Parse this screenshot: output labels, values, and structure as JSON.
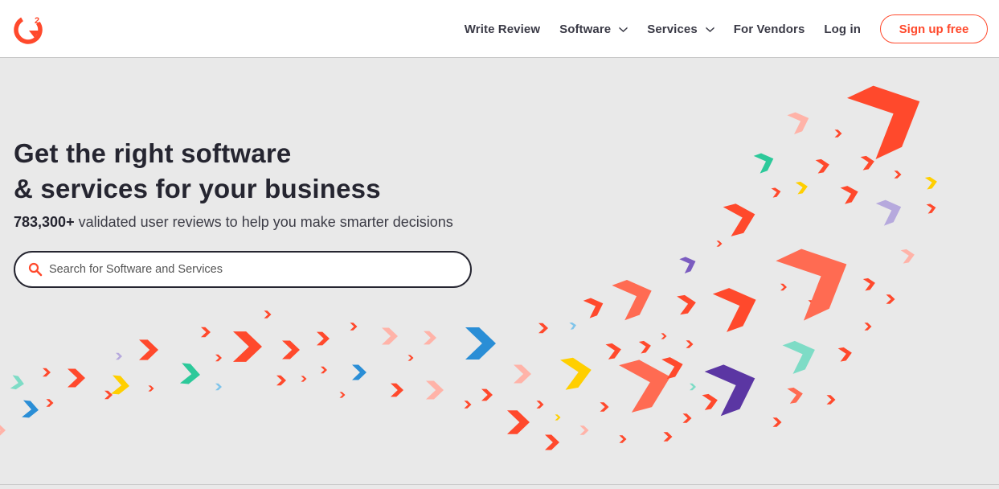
{
  "brand": {
    "logo_name": "G2",
    "accent": "#ff492c"
  },
  "nav": {
    "write_review": "Write Review",
    "software": "Software",
    "services": "Services",
    "for_vendors": "For Vendors",
    "login": "Log in",
    "signup": "Sign up free"
  },
  "hero": {
    "title_line1": "Get the right software",
    "title_line2": "& services for your business",
    "review_count": "783,300+",
    "subtitle": "validated user reviews to help you make smarter decisions",
    "search_placeholder": "Search for Software and Services"
  },
  "colors": {
    "background": "#e9e9e9",
    "red": "#ff492c",
    "coral": "#ff6b52",
    "salmon": "#ffb3a8",
    "blue": "#2a8ed6",
    "lightblue": "#7fc4ea",
    "yellow": "#ffcf00",
    "lightyellow": "#ffe37a",
    "teal": "#2cc99a",
    "mint": "#7edcc6",
    "purple": "#5b36a3",
    "violet": "#7b5cc0",
    "lavender": "#b6a9dd"
  }
}
